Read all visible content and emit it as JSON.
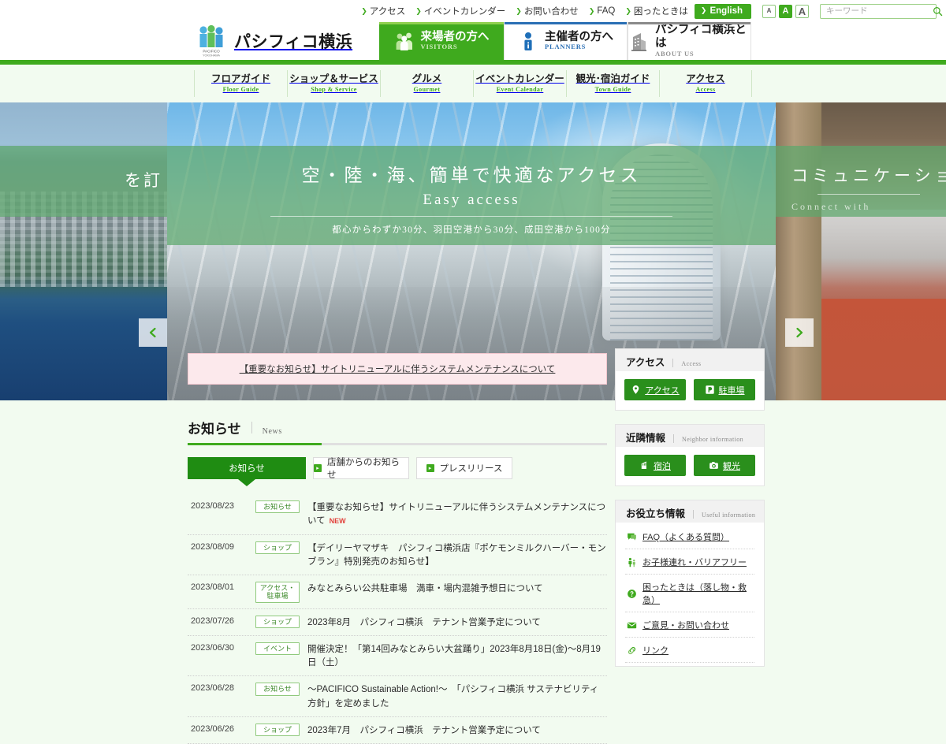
{
  "utility": {
    "links": [
      {
        "label": "アクセス"
      },
      {
        "label": "イベントカレンダー"
      },
      {
        "label": "お問い合わせ"
      },
      {
        "label": "FAQ"
      },
      {
        "label": "困ったときは"
      }
    ],
    "english_label": "English",
    "font_sizes": [
      {
        "label": "A",
        "active": false
      },
      {
        "label": "A",
        "active": true
      },
      {
        "label": "A",
        "active": false
      }
    ],
    "search": {
      "placeholder": "キーワード",
      "value": ""
    }
  },
  "header": {
    "logo_text": "パシフィコ横浜",
    "logo_mark_caption": "PACIFICO",
    "logo_mark_sub": "YOKOHAMA",
    "tabs": [
      {
        "ja": "来場者の方へ",
        "en": "VISITORS",
        "icon": "people-icon",
        "state": "active"
      },
      {
        "ja": "主催者の方へ",
        "en": "PLANNERS",
        "icon": "person-info-icon",
        "state": "default"
      },
      {
        "ja": "パシフィコ横浜とは",
        "en": "ABOUT US",
        "icon": "building-icon",
        "state": "default"
      }
    ]
  },
  "global_nav": [
    {
      "ja": "フロアガイド",
      "en": "Floor Guide"
    },
    {
      "ja": "ショップ＆サービス",
      "en": "Shop & Service"
    },
    {
      "ja": "グルメ",
      "en": "Gourmet"
    },
    {
      "ja": "イベントカレンダー",
      "en": "Event Calendar"
    },
    {
      "ja": "観光･宿泊ガイド",
      "en": "Town Guide"
    },
    {
      "ja": "アクセス",
      "en": "Access"
    }
  ],
  "hero": {
    "prev_slide": {
      "caption_ja": "を訂"
    },
    "main_slide": {
      "caption_ja": "空・陸・海、簡単で快適なアクセス",
      "caption_en": "Easy access",
      "caption_sub": "都心からわずか30分、羽田空港から30分、成田空港から100分"
    },
    "next_slide": {
      "caption_ja": "コミュニケーション",
      "caption_en": "Connect with"
    },
    "prev_arrow": "chevron-left-icon",
    "next_arrow": "chevron-right-icon"
  },
  "notice": {
    "text": "【重要なお知らせ】サイトリニューアルに伴うシステムメンテナンスについて"
  },
  "news_section": {
    "title_ja": "お知らせ",
    "title_en": "News",
    "tabs": [
      {
        "label": "お知らせ",
        "active": true
      },
      {
        "label": "店舗からのお知らせ",
        "active": false
      },
      {
        "label": "プレスリリース",
        "active": false
      }
    ],
    "items": [
      {
        "date": "2023/08/23",
        "badge": "お知らせ",
        "title": "【重要なお知らせ】サイトリニューアルに伴うシステムメンテナンスについて",
        "is_new": true,
        "new_label": "NEW"
      },
      {
        "date": "2023/08/09",
        "badge": "ショップ",
        "title": "【デイリーヤマザキ　パシフィコ横浜店『ポケモンミルクハーバー・モンブラン』特別発売のお知らせ】",
        "is_new": false,
        "new_label": ""
      },
      {
        "date": "2023/08/01",
        "badge": "アクセス・駐車場",
        "title": "みなとみらい公共駐車場　満車・場内混雑予想日について",
        "is_new": false,
        "new_label": ""
      },
      {
        "date": "2023/07/26",
        "badge": "ショップ",
        "title": "2023年8月　パシフィコ横浜　テナント営業予定について",
        "is_new": false,
        "new_label": ""
      },
      {
        "date": "2023/06/30",
        "badge": "イベント",
        "title": "開催決定！「第14回みなとみらい大盆踊り」2023年8月18日(金)〜8月19日（土）",
        "is_new": false,
        "new_label": ""
      },
      {
        "date": "2023/06/28",
        "badge": "お知らせ",
        "title": "〜PACIFICO Sustainable Action!〜　「パシフィコ横浜 サステナビリティ方針」を定めました",
        "is_new": false,
        "new_label": ""
      },
      {
        "date": "2023/06/26",
        "badge": "ショップ",
        "title": "2023年7月　パシフィコ横浜　テナント営業予定について",
        "is_new": false,
        "new_label": ""
      }
    ]
  },
  "sidebar": {
    "access_panel": {
      "title_ja": "アクセス",
      "title_en": "Access",
      "buttons": [
        {
          "label": "アクセス",
          "icon": "map-pin-icon"
        },
        {
          "label": "駐車場",
          "icon": "parking-icon"
        }
      ]
    },
    "neighbor_panel": {
      "title_ja": "近隣情報",
      "title_en": "Neighbor information",
      "buttons": [
        {
          "label": "宿泊",
          "icon": "hotel-icon"
        },
        {
          "label": "観光",
          "icon": "camera-icon"
        }
      ]
    },
    "useful_panel": {
      "title_ja": "お役立ち情報",
      "title_en": "Useful information",
      "items": [
        {
          "label": "FAQ（よくある質問）",
          "icon": "speech-bubble-icon"
        },
        {
          "label": "お子様連れ・バリアフリー",
          "icon": "family-icon"
        },
        {
          "label": "困ったときは（落し物・救急）",
          "icon": "question-circle-icon"
        },
        {
          "label": "ご意見・お問い合わせ",
          "icon": "mail-icon"
        },
        {
          "label": "リンク",
          "icon": "link-icon"
        }
      ]
    }
  },
  "colors": {
    "brand_green": "#3faa1e",
    "dark_green": "#1f8c12",
    "planner_blue": "#2a6fb5",
    "about_gray": "#8a8a8a",
    "page_bg": "#f2fbf0",
    "notice_bg": "#fce9ec",
    "new_red": "#e2423c"
  }
}
